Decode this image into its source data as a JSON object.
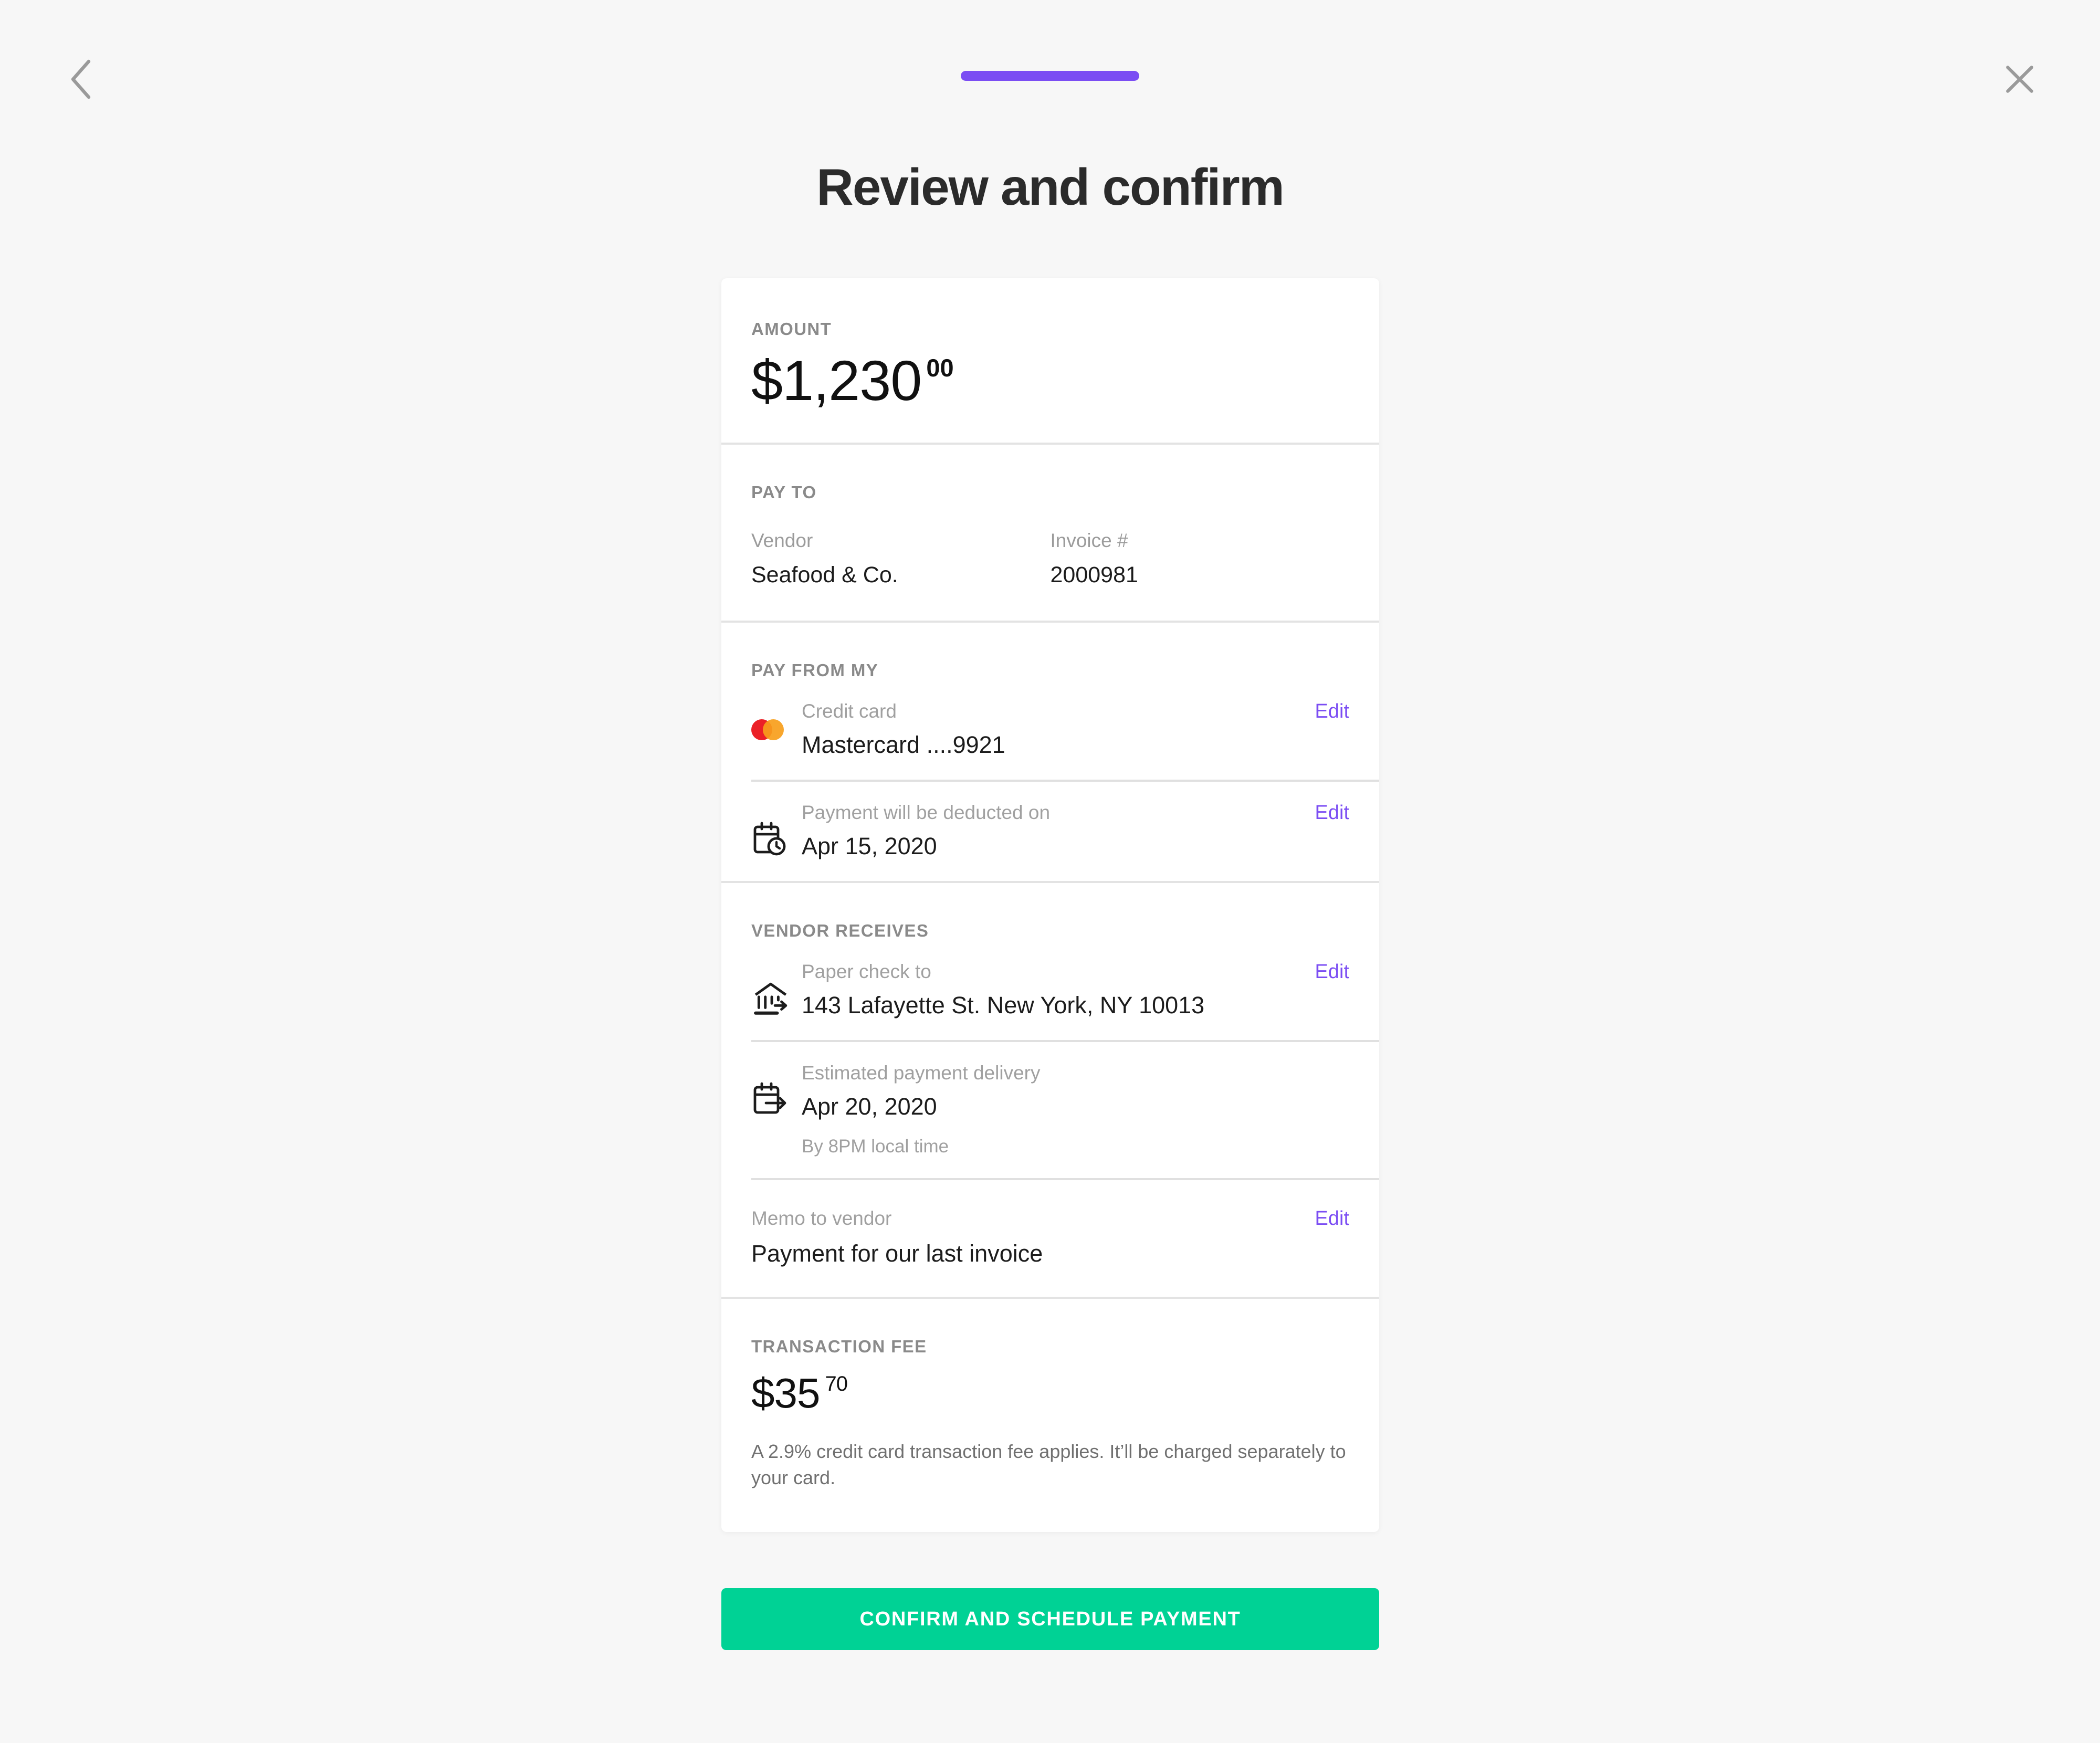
{
  "header": {
    "back_icon": "chevron-left-icon",
    "close_icon": "close-icon",
    "progress_percent": 100,
    "progress_color": "#7b4df3"
  },
  "page_title": "Review and confirm",
  "card": {
    "amount": {
      "label": "AMOUNT",
      "dollars": "$1,230",
      "cents": "00"
    },
    "pay_to": {
      "label": "PAY TO",
      "fields": [
        {
          "label": "Vendor",
          "value": "Seafood & Co."
        },
        {
          "label": "Invoice #",
          "value": "2000981"
        }
      ]
    },
    "pay_from_my": {
      "label": "PAY FROM MY",
      "rows": [
        {
          "icon": "mastercard-logo",
          "label": "Credit card",
          "value": "Mastercard ....9921",
          "edit_label": "Edit"
        },
        {
          "icon": "calendar-clock-icon",
          "label": "Payment will be deducted on",
          "value": "Apr 15, 2020",
          "edit_label": "Edit"
        }
      ]
    },
    "vendor_receives": {
      "label": "VENDOR RECEIVES",
      "rows": [
        {
          "icon": "bank-transfer-icon",
          "label": "Paper check to",
          "value": "143 Lafayette St. New York, NY 10013",
          "edit_label": "Edit"
        },
        {
          "icon": "calendar-arrow-icon",
          "label": "Estimated payment delivery",
          "value": "Apr 20, 2020",
          "sub": "By 8PM local time"
        }
      ]
    },
    "memo": {
      "label": "Memo to vendor",
      "value": "Payment for our last invoice",
      "edit_label": "Edit"
    },
    "transaction_fee": {
      "label": "TRANSACTION FEE",
      "dollars": "$35",
      "cents": "70",
      "note": "A 2.9% credit card transaction fee applies. It’ll be charged separately to your card."
    }
  },
  "cta": {
    "label": "CONFIRM AND SCHEDULE PAYMENT",
    "color": "#00d295"
  },
  "colors": {
    "accent_purple": "#7b4df3",
    "cta_green": "#00d295",
    "page_background": "#f7f7f7",
    "card_background": "#ffffff"
  }
}
